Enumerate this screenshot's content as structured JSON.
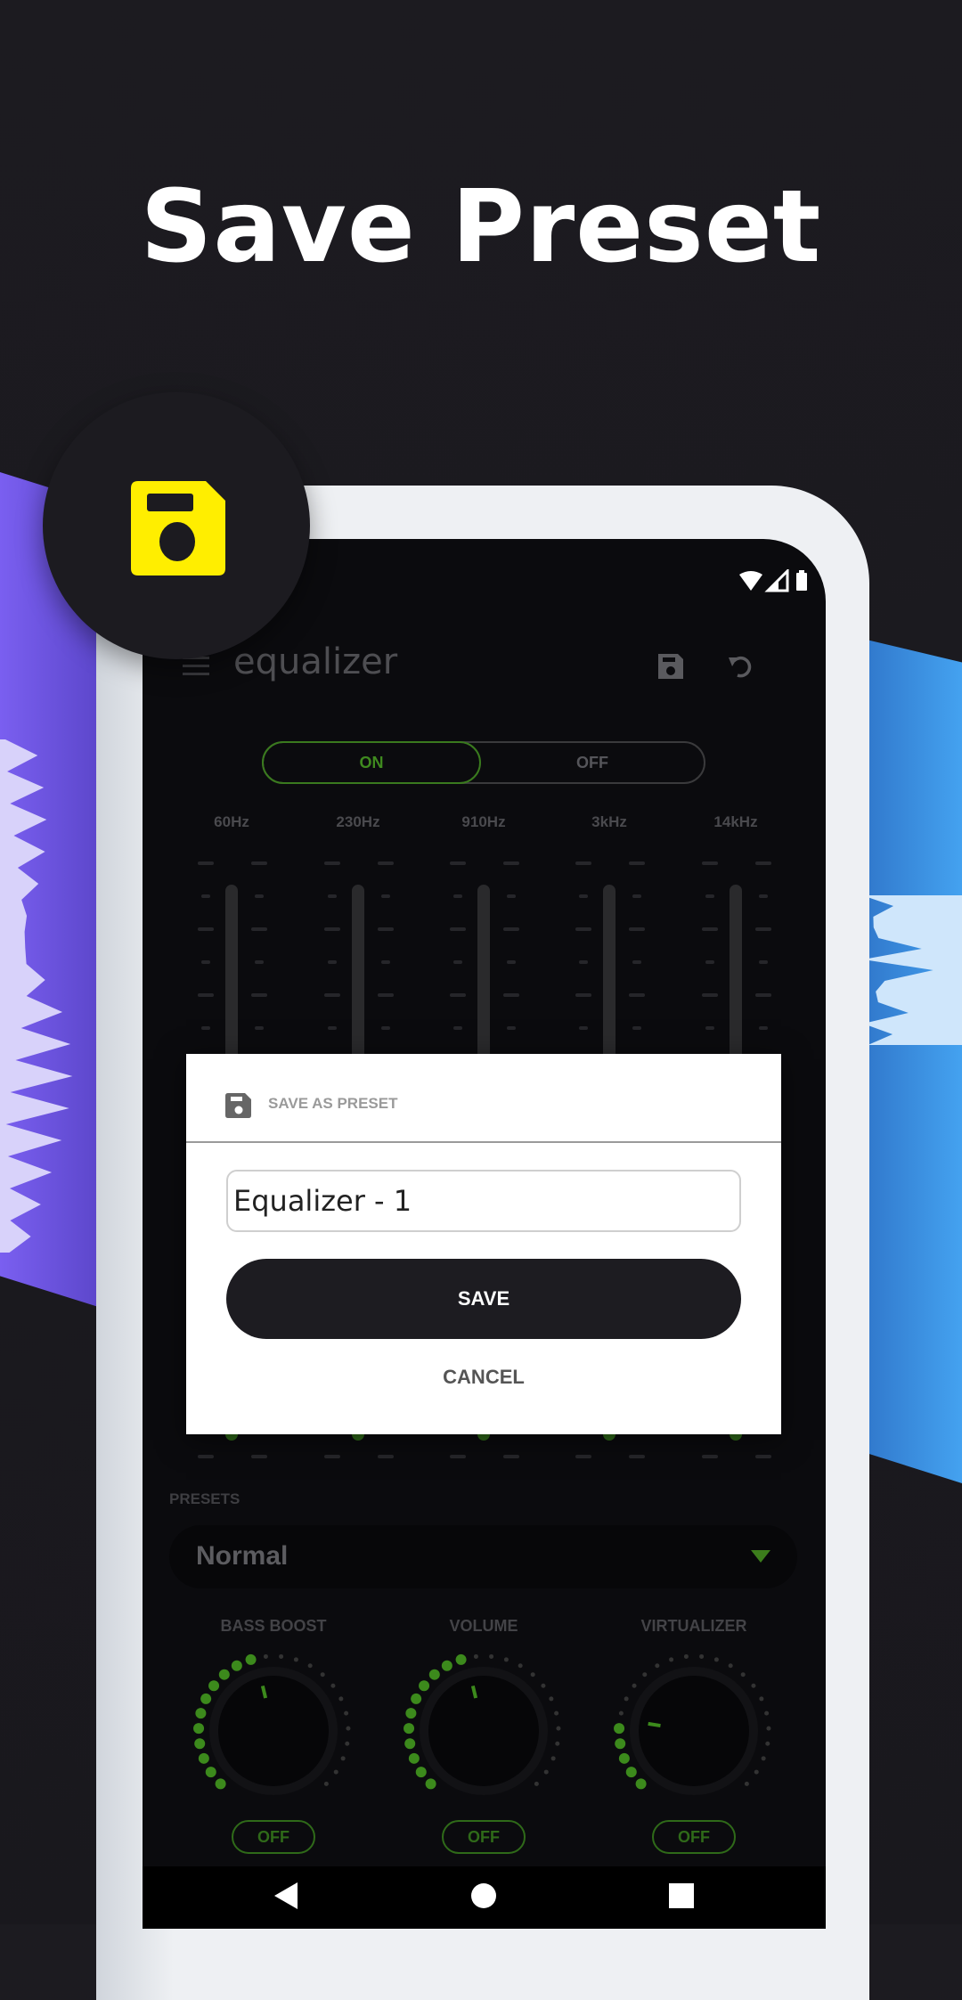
{
  "headline": "Save Preset",
  "colors": {
    "accent_yellow": "#ffee00",
    "accent_green": "#3f8a1f",
    "purple": "#7a5ff0",
    "blue": "#44a2f0"
  },
  "badge_icon": "floppy-disk-icon",
  "app": {
    "title": "equalizer",
    "toolbar_icons": [
      "menu-icon",
      "save-icon",
      "undo-icon"
    ],
    "toggle": {
      "on": "ON",
      "off": "OFF",
      "state": "ON"
    },
    "bands": [
      "60Hz",
      "230Hz",
      "910Hz",
      "3kHz",
      "14kHz"
    ],
    "presets": {
      "label": "PRESETS",
      "selected": "Normal"
    },
    "knobs": [
      {
        "label": "BASS BOOST",
        "button": "OFF",
        "level": 0.45
      },
      {
        "label": "VOLUME",
        "button": "OFF",
        "level": 0.45
      },
      {
        "label": "VIRTUALIZER",
        "button": "OFF",
        "level": 0.2
      }
    ]
  },
  "dialog": {
    "title": "SAVE AS PRESET",
    "input_value": "Equalizer - 1",
    "save": "SAVE",
    "cancel": "CANCEL"
  }
}
